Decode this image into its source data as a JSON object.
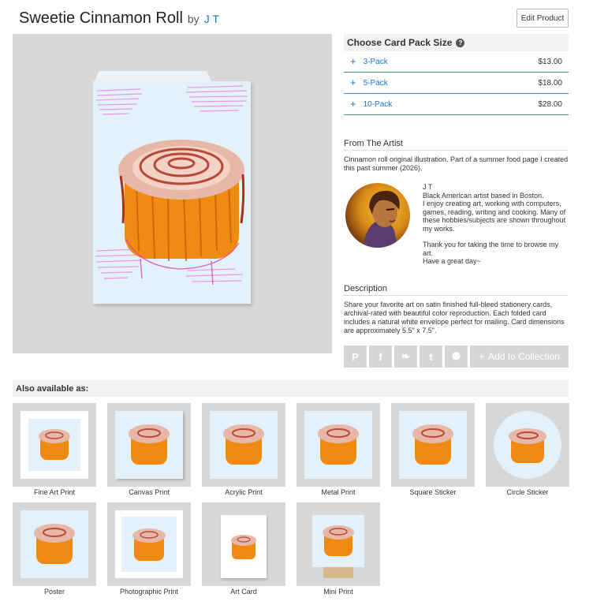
{
  "header": {
    "title": "Sweetie Cinnamon Roll",
    "by": "by",
    "artist": "J T",
    "edit_button": "Edit Product"
  },
  "pack": {
    "heading": "Choose Card Pack Size",
    "help_glyph": "?",
    "options": [
      {
        "label": "3-Pack",
        "price": "$13.00"
      },
      {
        "label": "5-Pack",
        "price": "$18.00"
      },
      {
        "label": "10-Pack",
        "price": "$28.00"
      }
    ]
  },
  "from_artist": {
    "heading": "From The Artist",
    "text": "Cinnamon roll original illustration. Part of a summer food page I created this past summer (2026).",
    "name": "J T",
    "bio_1": "Black American artist based in Boston.",
    "bio_2": "I enjoy creating art, working with computers, games, reading, writing and cooking. Many of these hobbies/subjects are shown throughout my works.",
    "bio_3": "Thank you for taking the time to browse my art.",
    "bio_4": "Have a great day~"
  },
  "description": {
    "heading": "Description",
    "text": "Share your favorite art on satin finished full-bleed stationery cards, archival-rated with beautiful color reproduction. Each folded card includes a natural white envelope perfect for mailing. Card dimensions are approximately 5.5\" x 7.5\"."
  },
  "share": {
    "icons": [
      "pinterest-icon",
      "facebook-icon",
      "bluesky-icon",
      "tumblr-icon",
      "reddit-icon"
    ],
    "pinterest_glyph": "P",
    "facebook_glyph": "f",
    "bluesky_glyph": "❧",
    "tumblr_glyph": "t",
    "reddit_glyph": "⚉",
    "collection_plus": "+",
    "collection_label": "Add to Collection"
  },
  "also": {
    "heading": "Also available as:",
    "products": [
      "Fine Art Print",
      "Canvas Print",
      "Acrylic Print",
      "Metal Print",
      "Square Sticker",
      "Circle Sticker",
      "Poster",
      "Photographic Print",
      "Art Card",
      "Mini Print"
    ]
  },
  "colors": {
    "link": "#1a73c9",
    "divider": "#3d86c6",
    "bg_light": "#e4f1fb",
    "roll_orange": "#f08a12"
  }
}
